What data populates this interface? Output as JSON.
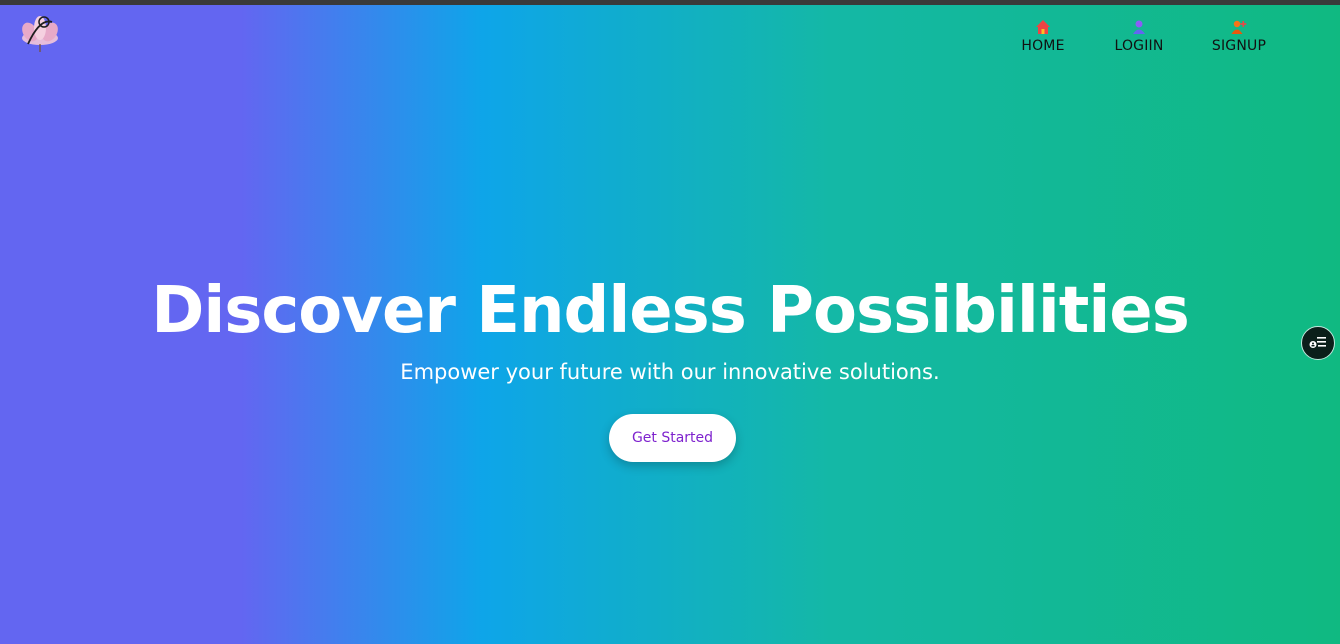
{
  "nav": {
    "items": [
      {
        "label": "HOME",
        "icon": "home-icon",
        "color": "#ef4444"
      },
      {
        "label": "LOGIIN",
        "icon": "user-icon",
        "color": "#8b5cf6"
      },
      {
        "label": "SIGNUP",
        "icon": "user-plus-icon",
        "color": "#f97316"
      }
    ]
  },
  "hero": {
    "title": "Discover Endless Possibilities",
    "subtitle": "Empower your future with our innovative solutions.",
    "cta_label": "Get Started"
  },
  "colors": {
    "gradient_start": "#6366f1",
    "gradient_mid": "#0ea5e9",
    "gradient_end": "#10b981",
    "cta_text": "#7e22ce"
  },
  "floating_button": {
    "icon": "accessibility-menu-icon"
  },
  "logo": {
    "icon": "lotus-pen-logo"
  }
}
